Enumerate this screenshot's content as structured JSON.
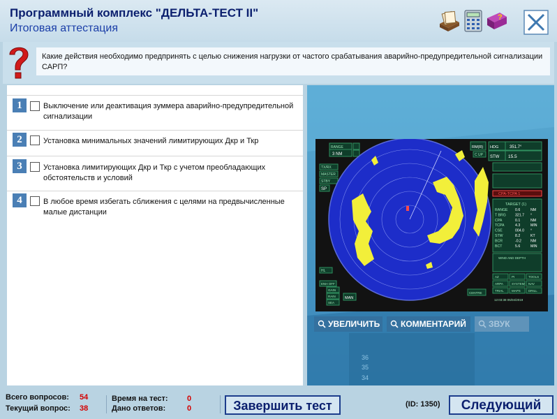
{
  "header": {
    "title": "Программный комплекс \"ДЕЛЬТА-ТЕСТ II\"",
    "subtitle": "Итоговая аттестация"
  },
  "question": {
    "text": "Какие действия необходимо предпринять с целью снижения нагрузки от частого срабатывания аварийно-предупредительной сигнализации САРП?"
  },
  "answers": [
    {
      "num": "1",
      "text": "Выключение или деактивация зуммера аварийно-предупредительной сигнализации"
    },
    {
      "num": "2",
      "text": "Установка минимальных значений лимитирующих Дкр и Ткр"
    },
    {
      "num": "3",
      "text": "Установка лимитирующих Дкр и Ткр с учетом преобладающих обстоятельств и условий"
    },
    {
      "num": "4",
      "text": "В любое время избегать сближения с целями на предвычисленные малые дистанции"
    }
  ],
  "image_buttons": {
    "zoom": "УВЕЛИЧИТЬ",
    "comment": "КОММЕНТАРИЙ",
    "sound": "ЗВУК"
  },
  "radar": {
    "range_label": "RANGE",
    "range_value": "3 NM",
    "hdg_label": "HDG",
    "hdg_value": "351.7°",
    "stw_label": "STW",
    "stw_value": "15.5",
    "mode": "RM(R)",
    "cup": "C UP",
    "cpa_tcpa": "CPA-TCPA 1",
    "target_title": "TARGET (1)",
    "target_rows": [
      {
        "k": "RANGE",
        "v": "0.6",
        "u": "NM"
      },
      {
        "k": "T BRG",
        "v": "321.7",
        "u": "°"
      },
      {
        "k": "CPA",
        "v": "0.1",
        "u": "NM"
      },
      {
        "k": "TCPA",
        "v": "4.3",
        "u": "MIN"
      },
      {
        "k": "CSE",
        "v": "004.0",
        "u": "°"
      },
      {
        "k": "STW",
        "v": "8.2",
        "u": "KT"
      },
      {
        "k": "BCR",
        "v": "-0.2",
        "u": "NM"
      },
      {
        "k": "BCT",
        "v": "5.6",
        "u": "MIN"
      }
    ],
    "wind": "WIND AND DEPTH",
    "timestamp": "12:03:38 05/04/2019",
    "left_buttons": [
      "TX/RX",
      "MASTER",
      "STBY",
      "SP"
    ],
    "bottom_left": [
      "ENH OFF",
      "GAIN",
      "RAIN",
      "SEA"
    ],
    "man": "MAN",
    "hl": "HL",
    "centre": "CENTRE",
    "right_grid": [
      "AZ",
      "PI",
      "TOOLS",
      "ARPA",
      "SYSTEM",
      "NAV",
      "TRIAL",
      "MAPS",
      "DRILL"
    ]
  },
  "background_numbers": [
    "36",
    "35",
    "34"
  ],
  "footer": {
    "total_label": "Всего вопросов:",
    "total_value": "54",
    "current_label": "Текущий вопрос:",
    "current_value": "38",
    "time_label": "Время на тест:",
    "time_value": "0",
    "answered_label": "Дано ответов:",
    "answered_value": "0",
    "finish_button": "Завершить тест",
    "id_text": "(ID: 1350)",
    "next_button": "Следующий"
  }
}
